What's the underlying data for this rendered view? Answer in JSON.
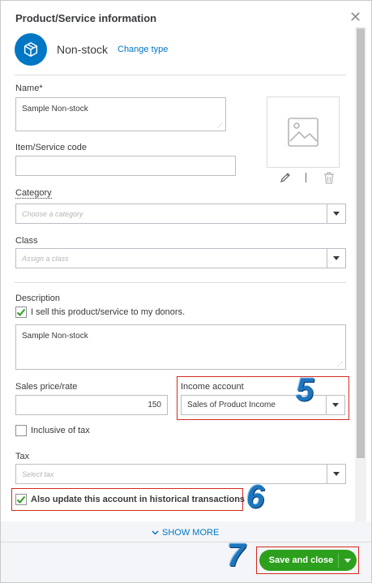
{
  "header": {
    "title": "Product/Service information",
    "close_symbol": "✕"
  },
  "type": {
    "label": "Non-stock",
    "change_link": "Change type",
    "icon": "box-icon"
  },
  "form": {
    "name_label": "Name*",
    "name_value": "Sample Non-stock",
    "code_label": "Item/Service code",
    "code_value": "",
    "category_label": "Category",
    "category_placeholder": "Choose a category",
    "class_label": "Class",
    "class_placeholder": "Assign a class",
    "description_label": "Description",
    "sell_checkbox_label": "I sell this product/service to my donors.",
    "sell_checked": true,
    "description_value": "Sample Non-stock",
    "sales_price_label": "Sales price/rate",
    "sales_price_value": "150",
    "income_account_label": "Income account",
    "income_account_value": "Sales of Product Income",
    "inclusive_label": "Inclusive of tax",
    "inclusive_checked": false,
    "tax_label": "Tax",
    "tax_placeholder": "Select tax",
    "update_label": "Also update this account in historical transactions",
    "update_checked": true
  },
  "show_more": "SHOW MORE",
  "save_button": "Save and close",
  "annotations": {
    "step5": "5",
    "step6": "6",
    "step7": "7"
  },
  "colors": {
    "brand_blue": "#0077c5",
    "save_green": "#2ca01c",
    "annotation_red": "#d52b1e",
    "step_blue": "#1d75bd"
  }
}
